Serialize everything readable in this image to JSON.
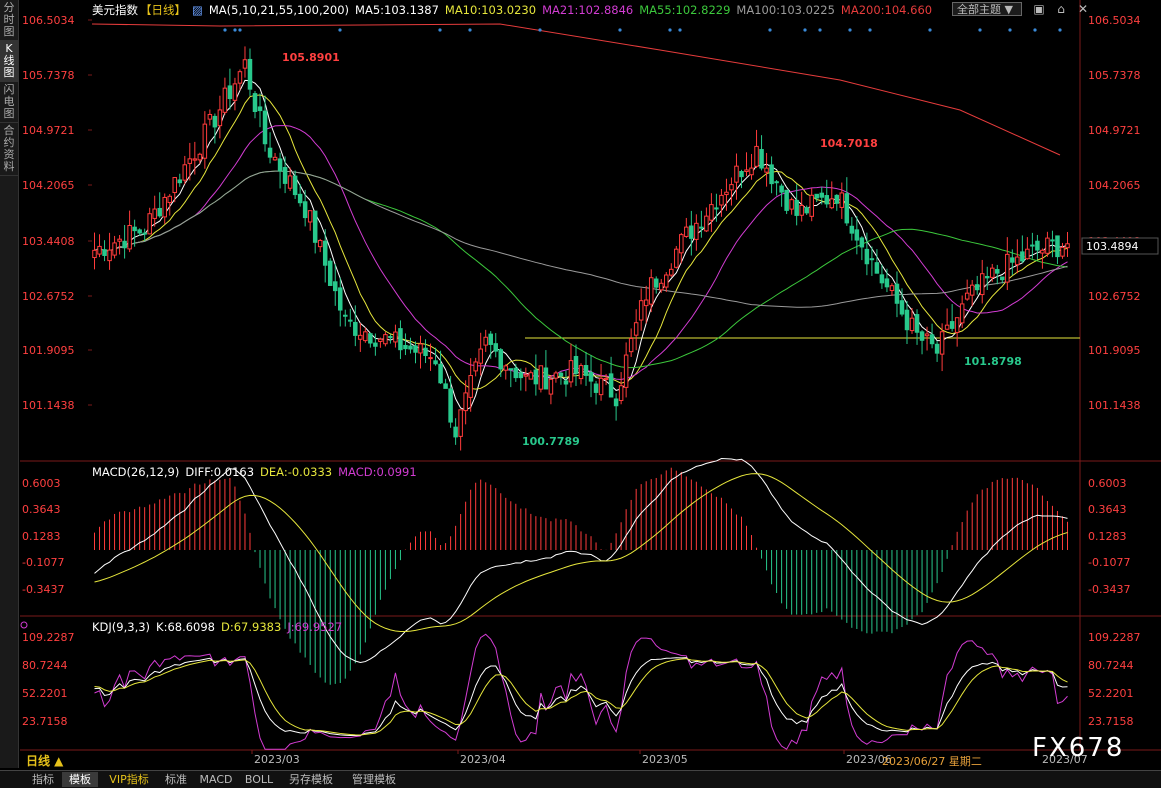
{
  "left_tabs": [
    "分时图",
    "K线图",
    "闪电图",
    "合约资料"
  ],
  "active_left_tab": 1,
  "header": {
    "title": "美元指数",
    "period": "【日线】",
    "ma_label": "MA(5,10,21,55,100,200)",
    "ma5": "MA5:103.1387",
    "ma10": "MA10:103.0230",
    "ma21": "MA21:102.8846",
    "ma55": "MA55:102.8229",
    "ma100": "MA100:103.0225",
    "ma200": "MA200:104.660",
    "theme_button": "全部主题",
    "icons": [
      "image-icon",
      "lock-icon",
      "close-icon"
    ]
  },
  "price_axis": [
    "106.5034",
    "105.7378",
    "104.9721",
    "104.2065",
    "103.4408",
    "102.6752",
    "101.9095",
    "101.1438"
  ],
  "current_price": "103.4894",
  "annotations": {
    "high1": "105.8901",
    "high2": "104.7018",
    "low1": "100.7789",
    "low2": "101.8798"
  },
  "macd": {
    "label": "MACD(26,12,9)",
    "diff": "DIFF:0.0163",
    "dea": "DEA:-0.0333",
    "macd": "MACD:0.0991",
    "axis": [
      "0.6003",
      "0.3643",
      "0.1283",
      "-0.1077",
      "-0.3437"
    ]
  },
  "kdj": {
    "label": "KDJ(9,3,3)",
    "k": "K:68.6098",
    "d": "D:67.9383",
    "j": "J:69.9527",
    "axis": [
      "109.2287",
      "80.7244",
      "52.2201",
      "23.7158"
    ]
  },
  "time_axis": [
    "2023/03",
    "2023/04",
    "2023/05",
    "2023/06",
    "2023/06/27 星期二",
    "2023/07"
  ],
  "period_tag": "日线 ▲",
  "watermark": "FX678",
  "bottom_tabs": [
    "指标",
    "模板",
    "VIP指标",
    "标准",
    "MACD",
    "BOLL",
    "另存模板",
    "管理模板"
  ],
  "active_bottom_tab": 1,
  "colors": {
    "up": "#ff3b3b",
    "down": "#28c88c",
    "ma5": "#ffffff",
    "ma10": "#e6e63c",
    "ma21": "#d23cd2",
    "ma55": "#3cc83c",
    "ma100": "#9a9a9a",
    "ma200": "#e63c3c",
    "axis_text": "#ff4040"
  }
}
